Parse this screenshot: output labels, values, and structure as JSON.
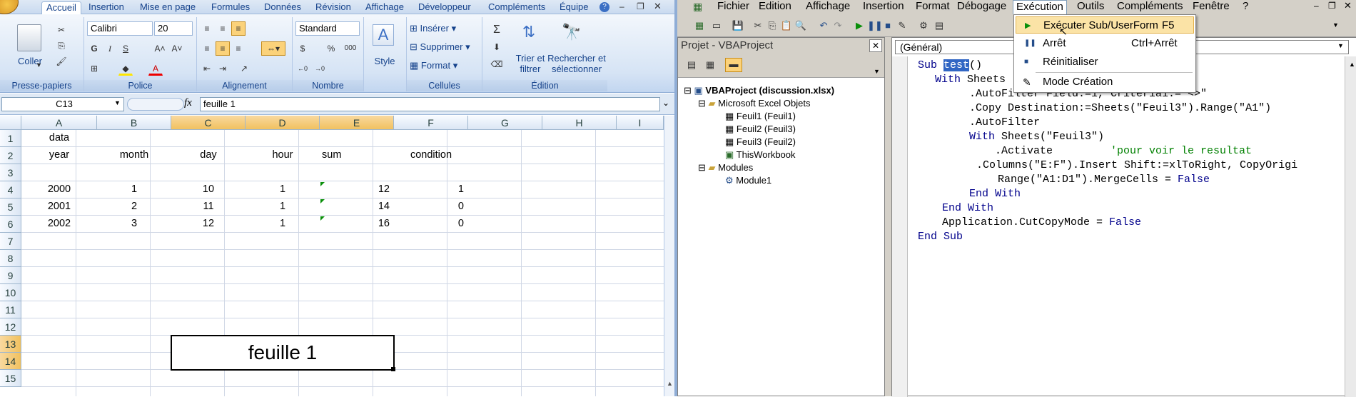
{
  "excel": {
    "tabs": [
      "Accueil",
      "Insertion",
      "Mise en page",
      "Formules",
      "Données",
      "Révision",
      "Affichage",
      "Développeur",
      "Compléments",
      "Équipe"
    ],
    "groups": {
      "clipboard": "Presse-papiers",
      "font": "Police",
      "alignment": "Alignement",
      "number": "Nombre",
      "cells": "Cellules",
      "editing": "Édition"
    },
    "paste_label": "Coller",
    "font_name": "Calibri",
    "font_size": "20",
    "number_format": "Standard",
    "style_label": "Style",
    "insert_label": "Insérer",
    "delete_label": "Supprimer",
    "format_label": "Format",
    "sort_label_1": "Trier et",
    "sort_label_2": "filtrer",
    "find_label_1": "Rechercher et",
    "find_label_2": "sélectionner",
    "bold": "G",
    "italic": "I",
    "underline": "S",
    "percent": "%",
    "thousands": "000",
    "fx": "fx",
    "name_box": "C13",
    "formula": "feuille 1",
    "columns": [
      "A",
      "B",
      "C",
      "D",
      "E",
      "F",
      "G",
      "H",
      "I"
    ],
    "rows": [
      "1",
      "2",
      "3",
      "4",
      "5",
      "6",
      "7",
      "8",
      "9",
      "10",
      "11",
      "12",
      "13",
      "14",
      "15"
    ],
    "cells": {
      "a1": "data",
      "a2": "year",
      "b2": "month",
      "c2": "day",
      "d2": "hour",
      "e2": "sum",
      "f2": "condition",
      "a4": "2000",
      "b4": "1",
      "c4": "10",
      "d4": "1",
      "e4": "12",
      "f4": "1",
      "a5": "2001",
      "b5": "2",
      "c5": "11",
      "d5": "1",
      "e5": "14",
      "f5": "0",
      "a6": "2002",
      "b6": "3",
      "c6": "12",
      "d6": "1",
      "e6": "16",
      "f6": "0",
      "merged": "feuille 1"
    }
  },
  "vba": {
    "menu": [
      "Fichier",
      "Edition",
      "Affichage",
      "Insertion",
      "Format",
      "Débogage",
      "Exécution",
      "Outils",
      "Compléments",
      "Fenêtre",
      "?"
    ],
    "project_title": "Projet - VBAProject",
    "tree": {
      "root": "VBAProject (discussion.xlsx)",
      "objects": "Microsoft Excel Objets",
      "sheets": [
        "Feuil1 (Feuil1)",
        "Feuil2 (Feuil3)",
        "Feuil3 (Feuil2)",
        "ThisWorkbook"
      ],
      "modules": "Modules",
      "module1": "Module1"
    },
    "object_combo": "(Général)",
    "code": {
      "l1a": "Sub ",
      "l1b": "test",
      "l1c": "()",
      "l2a": "With ",
      "l2b": "Sheets",
      "l3": ".AutoFilter Field:=1, Criteria1:=\"<>\"",
      "l4": ".Copy Destination:=Sheets(\"Feuil3\").Range(\"A1\")",
      "l5": ".AutoFilter",
      "l6a": "With ",
      "l6b": "Sheets(\"Feuil3\")",
      "l7a": ".Activate",
      "l7b": "'pour voir le resultat",
      "l8": ".Columns(\"E:F\").Insert Shift:=xlToRight, CopyOrigi",
      "l9a": "Range(\"A1:D1\").MergeCells = ",
      "l9b": "False",
      "l10": "End With",
      "l11": "End With",
      "l12a": "Application.CutCopyMode = ",
      "l12b": "False",
      "l13": "End Sub"
    },
    "dropdown": [
      {
        "label": "Exécuter Sub/UserForm",
        "shortcut": "F5"
      },
      {
        "label": "Arrêt",
        "shortcut": "Ctrl+Arrêt"
      },
      {
        "label": "Réinitialiser",
        "shortcut": ""
      },
      {
        "label": "Mode Création",
        "shortcut": ""
      }
    ]
  }
}
